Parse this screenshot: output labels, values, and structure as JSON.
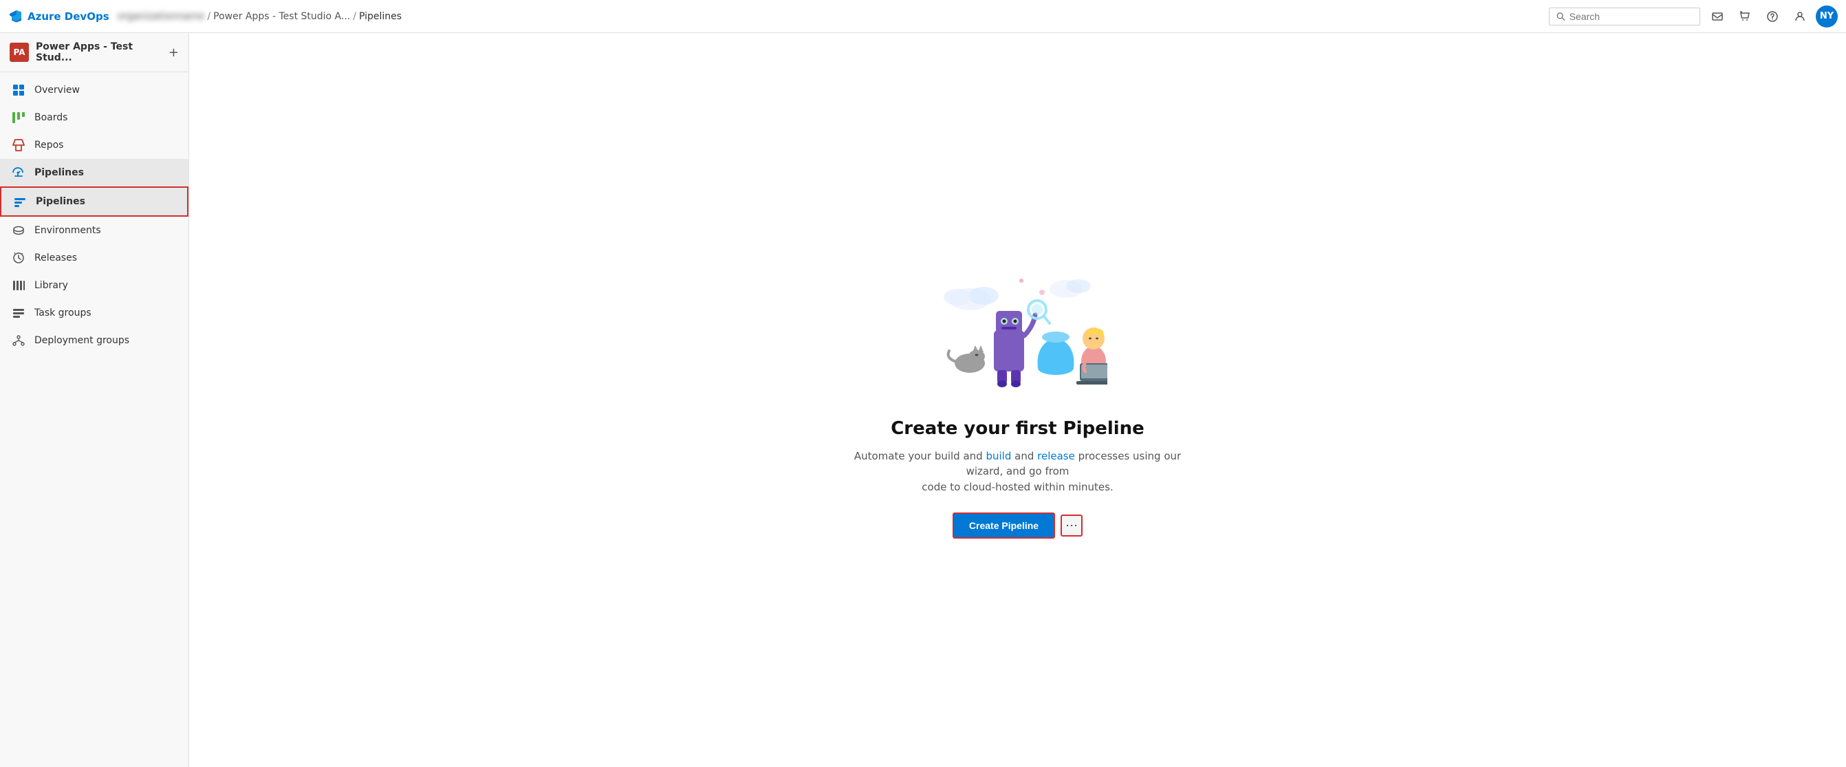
{
  "app": {
    "name": "Azure DevOps",
    "logo_text": "Azure DevOps"
  },
  "topbar": {
    "breadcrumbs": [
      {
        "id": "org",
        "label": "organizationname",
        "blurred": true
      },
      {
        "id": "project",
        "label": "Power Apps - Test Studio A..."
      },
      {
        "id": "current",
        "label": "Pipelines"
      }
    ],
    "search_placeholder": "Search",
    "avatar_initials": "NY"
  },
  "sidebar": {
    "project_avatar": "PA",
    "project_name": "Power Apps - Test Stud...",
    "nav_items": [
      {
        "id": "overview",
        "label": "Overview",
        "icon": "overview"
      },
      {
        "id": "boards",
        "label": "Boards",
        "icon": "boards"
      },
      {
        "id": "repos",
        "label": "Repos",
        "icon": "repos"
      },
      {
        "id": "pipelines",
        "label": "Pipelines",
        "icon": "pipelines",
        "active": true
      },
      {
        "id": "pipelines-sub",
        "label": "Pipelines",
        "icon": "pipelines-sub",
        "selected": true
      },
      {
        "id": "environments",
        "label": "Environments",
        "icon": "environments"
      },
      {
        "id": "releases",
        "label": "Releases",
        "icon": "releases"
      },
      {
        "id": "library",
        "label": "Library",
        "icon": "library"
      },
      {
        "id": "task-groups",
        "label": "Task groups",
        "icon": "task-groups"
      },
      {
        "id": "deployment-groups",
        "label": "Deployment groups",
        "icon": "deployment-groups"
      }
    ]
  },
  "main": {
    "title": "Create your first Pipeline",
    "description_part1": "Automate your build and ",
    "description_link1": "build",
    "description_part2": " and release processes using our wizard, and go from\n      code to cloud-hosted within minutes.",
    "description_link2": "release",
    "create_button_label": "Create Pipeline",
    "more_button_label": "⋯"
  }
}
